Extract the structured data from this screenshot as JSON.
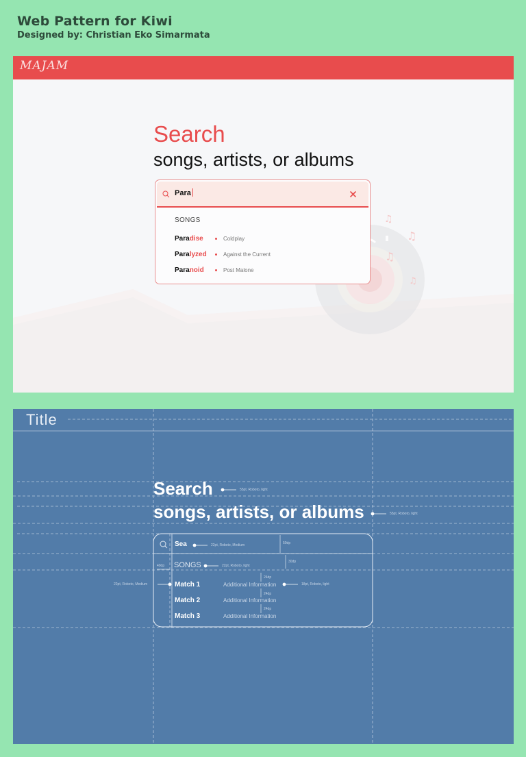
{
  "header": {
    "title": "Web Pattern for Kiwi",
    "subtitle": "Designed by: Christian Eko Simarmata"
  },
  "mockup": {
    "logo": "MAJAM",
    "search_title": "Search",
    "search_subtitle": "songs, artists, or albums",
    "search_typed_prefix": "Para",
    "section_header": "SONGS",
    "results": [
      {
        "match": "Para",
        "rest": "dise",
        "artist": "Coldplay"
      },
      {
        "match": "Para",
        "rest": "lyzed",
        "artist": "Against the Current"
      },
      {
        "match": "Para",
        "rest": "noid",
        "artist": "Post Malone"
      }
    ],
    "colors": {
      "brand": "#e84c4d",
      "field_bg": "#fbe9e5",
      "page_bg": "#f6f7f9"
    },
    "icons": {
      "search": "search-icon",
      "clear": "close-icon"
    }
  },
  "blueprint": {
    "title": "Title",
    "search_title": "Search",
    "search_subtitle": "songs, artists, or albums",
    "search_value": "Sea",
    "section_header": "SONGS",
    "matches": [
      {
        "name": "Match 1",
        "info": "Additional Information"
      },
      {
        "name": "Match 2",
        "info": "Additional Information"
      },
      {
        "name": "Match 3",
        "info": "Additional Information"
      }
    ],
    "annotations": {
      "title_spec": "55pt, Roboto, light",
      "subtitle_spec": "55pt, Roboto, light",
      "field_spec": "22pt, Roboto, Medium",
      "field_height": "50dp",
      "section_spec": "22pt, Roboto, light",
      "section_gap": "30dp",
      "left_margin": "40dp",
      "match_spec": "22pt, Roboto, Medium",
      "info_spec": "18pt, Roboto, light",
      "row_gap_1": "24dp",
      "row_gap_2": "24dp",
      "row_gap_3": "24dp"
    },
    "colors": {
      "bg": "#527ca9"
    }
  }
}
